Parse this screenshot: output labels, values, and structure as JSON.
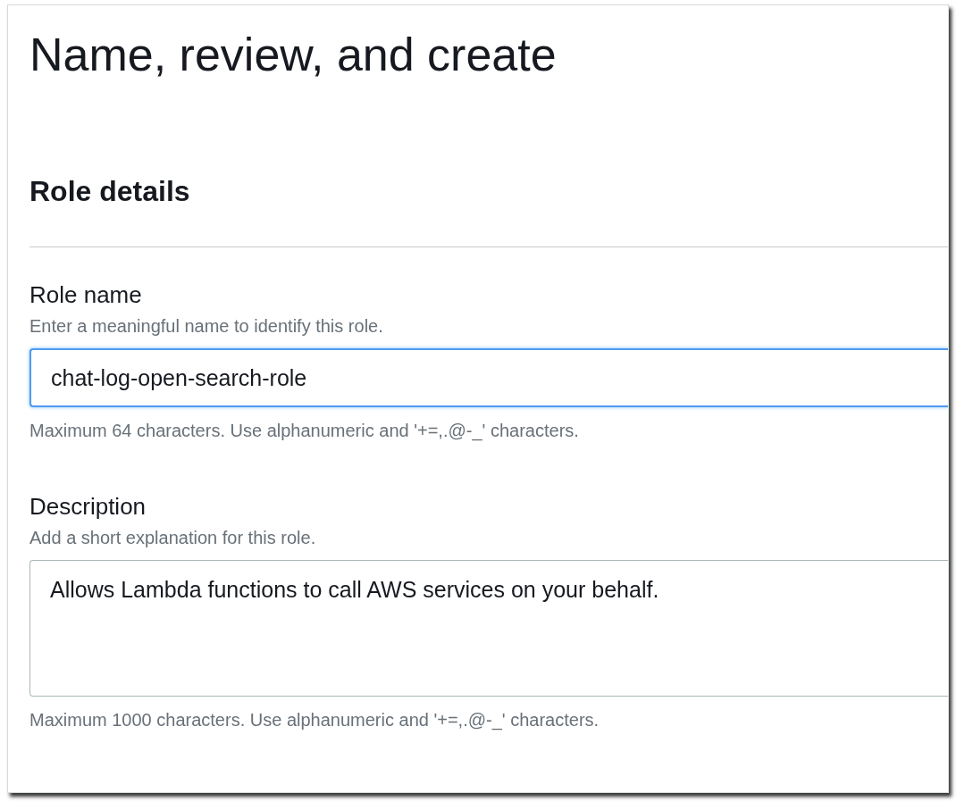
{
  "page": {
    "title": "Name, review, and create"
  },
  "section": {
    "title": "Role details"
  },
  "fields": [
    {
      "kind": "input",
      "label": "Role name",
      "hint": "Enter a meaningful name to identify this role.",
      "value": "chat-log-open-search-role",
      "constraint": "Maximum 64 characters. Use alphanumeric and '+=,.@-_' characters.",
      "focused": true
    },
    {
      "kind": "textarea",
      "label": "Description",
      "hint": "Add a short explanation for this role.",
      "value": "Allows Lambda functions to call AWS services on your behalf.",
      "constraint": "Maximum 1000 characters. Use alphanumeric and '+=,.@-_' characters.",
      "focused": false
    }
  ]
}
